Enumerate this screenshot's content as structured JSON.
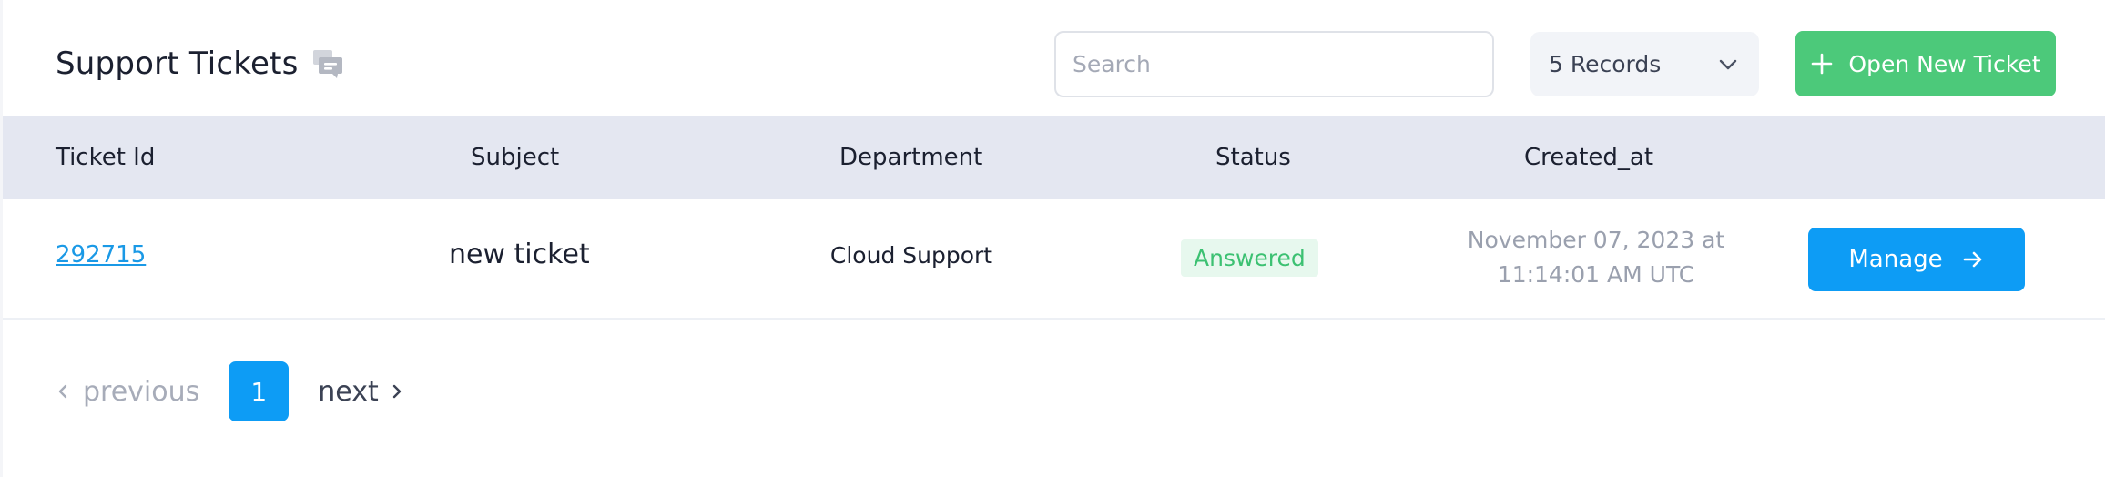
{
  "header": {
    "title": "Support Tickets",
    "title_icon": "chat-bubbles-icon",
    "search_placeholder": "Search",
    "records_select": {
      "selected": "5 Records"
    },
    "open_ticket_label": "Open New Ticket"
  },
  "table": {
    "columns": [
      "Ticket Id",
      "Subject",
      "Department",
      "Status",
      "Created_at"
    ],
    "rows": [
      {
        "ticket_id": "292715",
        "subject": "new ticket",
        "department": "Cloud Support",
        "status": "Answered",
        "created_at": "November 07, 2023 at 11:14:01 AM UTC",
        "action_label": "Manage"
      }
    ]
  },
  "pagination": {
    "previous_label": "previous",
    "current_page": "1",
    "next_label": "next"
  },
  "colors": {
    "accent_blue": "#0d9cf5",
    "success_green": "#4cc97a",
    "status_answered_text": "#3cc172",
    "status_answered_bg": "#e7f8ee",
    "header_bg": "#e4e7f1"
  }
}
